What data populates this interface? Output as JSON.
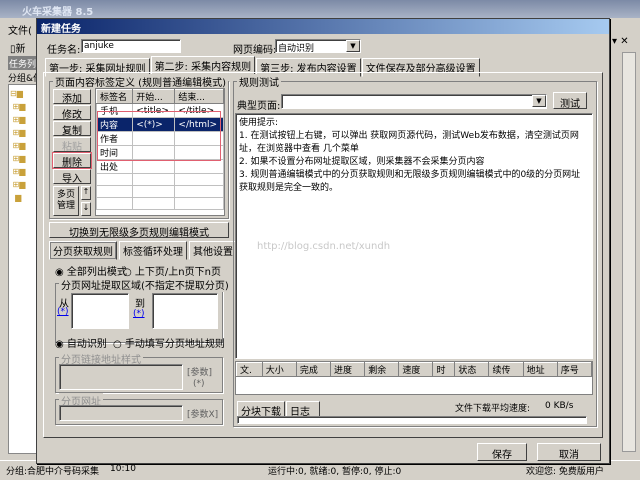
{
  "app": {
    "title": "火车采集器 8.5",
    "menu_file": "文件(",
    "toolbar_new": "新",
    "task_list_tab": "任务列",
    "group_label": "分组&任",
    "status": {
      "group": "分组:合肥中介号码采集",
      "time": "10:10",
      "counts": "运行中:0, 就绪:0, 暂停:0, 停止:0",
      "welcome": "欢迎您: 免费版用户"
    }
  },
  "dialog": {
    "title": "新建任务",
    "task_name_label": "任务名:",
    "task_name_value": "anjuke",
    "encoding_label": "网页编码:",
    "encoding_value": "自动识别",
    "tabs": [
      "第一步: 采集网址规则",
      "第二步: 采集内容规则",
      "第三步: 发布内容设置",
      "文件保存及部分高级设置"
    ],
    "tag_group_title": "页面内容标签定义  (规则普通编辑模式)",
    "tag_buttons": [
      "添加",
      "修改",
      "复制",
      "粘贴",
      "删除",
      "导入"
    ],
    "multipage_button": "多页管理",
    "tag_table": {
      "headers": [
        "标签名",
        "开始...",
        "结束..."
      ],
      "rows": [
        [
          "手机",
          "<title>",
          "</title>"
        ],
        [
          "内容",
          "<(*)>",
          "</html>"
        ],
        [
          "作者",
          "",
          ""
        ],
        [
          "时间",
          "",
          ""
        ],
        [
          "出处",
          "",
          ""
        ]
      ]
    },
    "switch_mode_button": "切换到无限级多页规则编辑模式",
    "sub_tabs": [
      "分页获取规则",
      "标签循环处理",
      "其他设置"
    ],
    "radio_all": "全部列出模式",
    "radio_prevnext": "上下页/上n页下n页",
    "page_region_title": "分页网址提取区域(不指定不提取分页)",
    "from_label": "从",
    "to_label": "到",
    "wildcard": "(*)",
    "radio_auto": "自动识别",
    "radio_manual": "手动填写分页地址规则",
    "link_style_title": "分页链接地址样式",
    "param_label": "[参数]",
    "param_star": "(*)",
    "page_url_title": "分页网址",
    "param_x_label": "[参数X]",
    "rule_test_title": "规则测试",
    "typical_page_label": "典型页面:",
    "test_button": "测试",
    "tips": [
      "使用提示:",
      "1. 在测试按钮上右键，可以弹出 获取网页源代码，测试Web发布数据，清空测试页网址，在浏览器中查看 几个菜单",
      "2. 如果不设置分布网址提取区域，则采集器不会采集分页内容",
      "3. 规则普通编辑模式中的分页获取规则和无限级多页规则编辑模式中的0级的分页网址获取规则是完全一致的。"
    ],
    "watermark": "http://blog.csdn.net/xundh",
    "download_headers": [
      "文.",
      "大小",
      "完成",
      "进度",
      "剩余",
      "速度",
      "时",
      "状态",
      "续传",
      "地址",
      "序号"
    ],
    "bottom_tabs": [
      "分块下载",
      "日志"
    ],
    "avg_speed_label": "文件下载平均速度:",
    "avg_speed_value": "0 KB/s",
    "save_button": "保存",
    "cancel_button": "取消"
  },
  "colors": {
    "title_bar": "#0a246a",
    "selection": "#0a246a",
    "highlight_box": "#e06070"
  }
}
